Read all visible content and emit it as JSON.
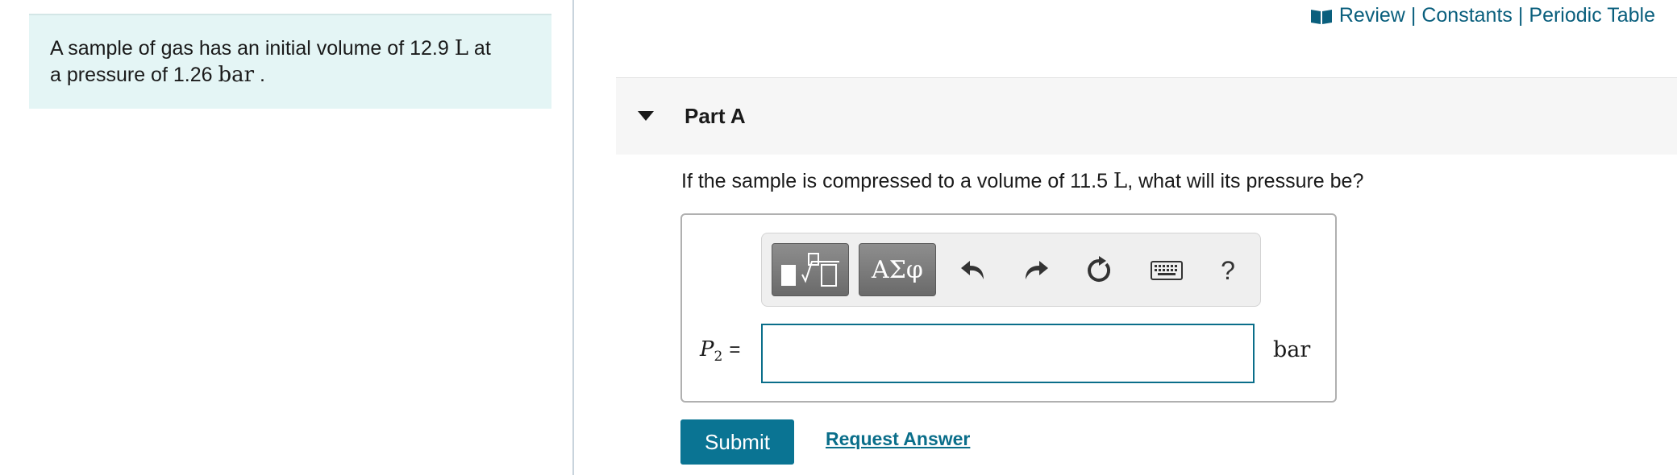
{
  "problem": {
    "text_1": "A sample of gas has an initial volume of 12.9",
    "volume_unit": "L",
    "text_2": "at",
    "text_3": "a pressure of 1.26",
    "pressure_unit": "bar",
    "text_4": "."
  },
  "top_links": {
    "review": "Review",
    "separator": "|",
    "constants": "Constants",
    "periodic_table": "Periodic Table",
    "icon": "book-icon"
  },
  "part": {
    "title": "Part A",
    "question_1": "If the sample is compressed to a volume of 11.5",
    "question_unit": "L",
    "question_2": ", what will its pressure be?"
  },
  "toolbar": {
    "templates_icon": "templates-icon",
    "greek_label": "ΑΣφ",
    "undo_icon": "undo-icon",
    "redo_icon": "redo-icon",
    "reset_icon": "reset-icon",
    "keyboard_icon": "keyboard-icon",
    "help_label": "?"
  },
  "answer": {
    "variable": "P",
    "subscript": "2",
    "equals": "=",
    "value": "",
    "unit": "bar"
  },
  "actions": {
    "submit_label": "Submit",
    "request_label": "Request Answer"
  },
  "colors": {
    "problem_bg": "#e4f5f5",
    "link": "#0a5f7d",
    "submit_bg": "#0a7493",
    "input_border": "#0a6e8a"
  }
}
